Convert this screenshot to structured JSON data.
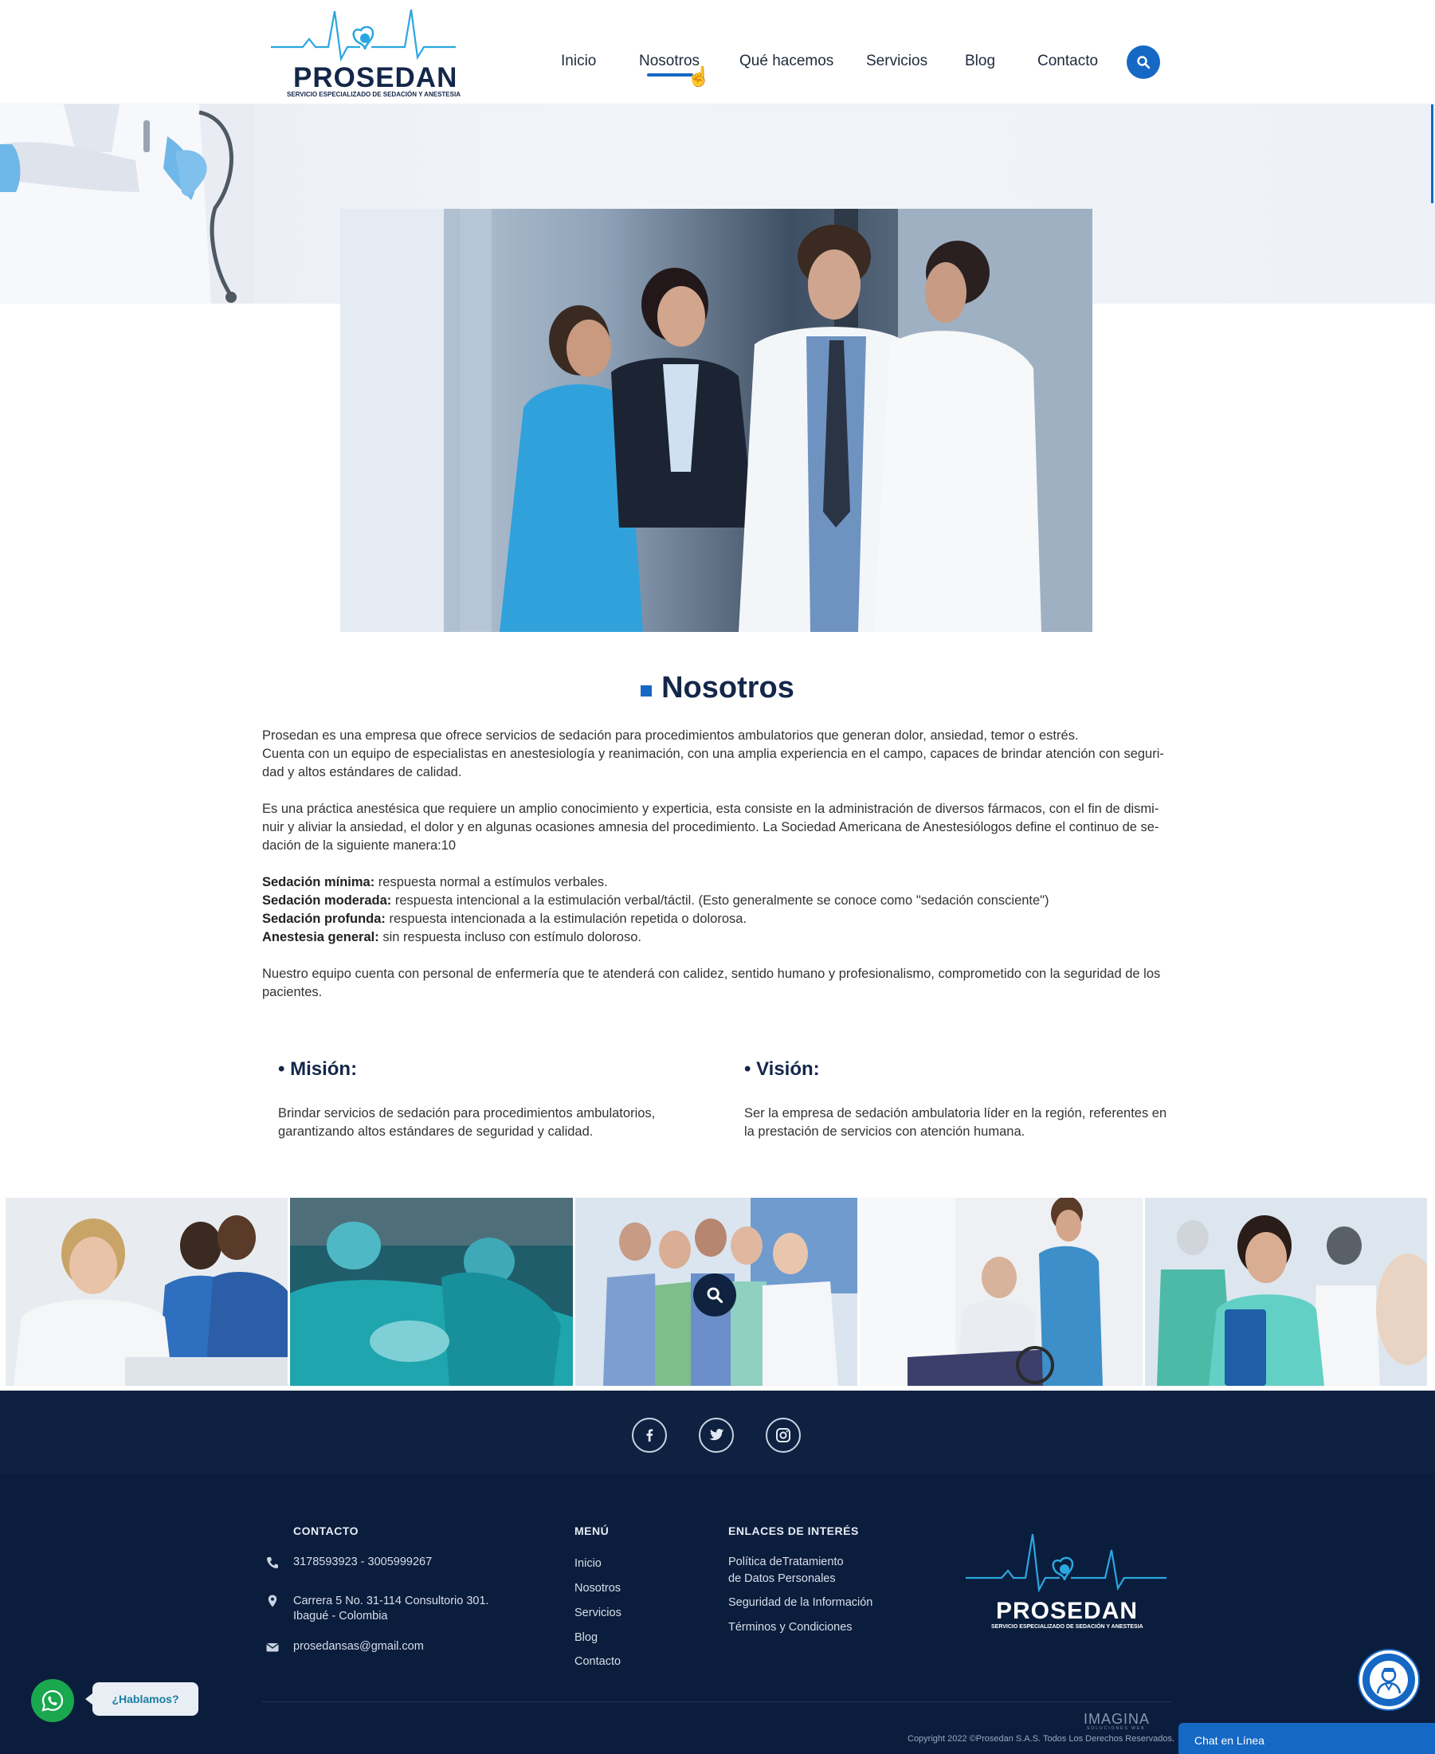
{
  "brand": {
    "name": "PROSEDAN",
    "tagline": "SERVICIO ESPECIALIZADO DE SEDACIÓN Y ANESTESIA",
    "primary_color": "#1568c4",
    "navy_color": "#0b1d3c"
  },
  "nav": {
    "items": [
      "Inicio",
      "Nosotros",
      "Qué hacemos",
      "Servicios",
      "Blog",
      "Contacto"
    ],
    "active": "Nosotros",
    "search_icon": "search-icon"
  },
  "page": {
    "title": "Nosotros",
    "paragraphs": {
      "p1a": "Prosedan es una empresa que ofrece servicios de sedación para procedimientos ambulatorios que generan dolor, ansiedad, temor o estrés.",
      "p1b": "Cuenta con un equipo de especialistas en anestesiología y reanimación, con una amplia experiencia en el campo, capaces de brindar atención con seguri-dad y altos estándares de calidad.",
      "p2": "Es una práctica anestésica que requiere un amplio conocimiento y experticia, esta consiste en la administración de diversos fármacos, con el fin de dismi-nuir y aliviar la ansiedad, el dolor y en algunas ocasiones amnesia del procedimiento. La Sociedad Americana de Anestesiólogos define el continuo de se-dación de la siguiente manera:10",
      "levels": [
        {
          "term": "Sedación mínima:",
          "desc": " respuesta normal a estímulos verbales."
        },
        {
          "term": "Sedación moderada:",
          "desc": " respuesta intencional a la estimulación verbal/táctil. (Esto generalmente se conoce como \"sedación consciente\")"
        },
        {
          "term": "Sedación profunda:",
          "desc": " respuesta intencionada a la estimulación repetida o dolorosa."
        },
        {
          "term": "Anestesia general:",
          "desc": " sin respuesta  incluso con estímulo doloroso."
        }
      ],
      "p4": "Nuestro equipo cuenta con personal de enfermería que te atenderá con calidez, sentido humano y profesionalismo, comprometido con la seguridad de los pacientes."
    },
    "mision": {
      "title": "• Misión:",
      "text": "Brindar servicios de sedación para procedimientos ambulatorios, garantizando altos estándares de seguridad y calidad."
    },
    "vision": {
      "title": "• Visión:",
      "text": "Ser la empresa de sedación ambulatoria líder en la región, referentes en la prestación de servicios con atención humana."
    }
  },
  "gallery": {
    "count": 5,
    "zoom_icon": "search-icon"
  },
  "social": [
    "facebook-icon",
    "twitter-icon",
    "instagram-icon"
  ],
  "footer": {
    "contact_heading": "CONTACTO",
    "phone": "3178593923 - 3005999267",
    "address_line1": "Carrera 5 No. 31-114 Consultorio 301.",
    "address_line2": "Ibagué - Colombia",
    "email": "prosedansas@gmail.com",
    "menu_heading": "MENÚ",
    "menu": [
      "Inicio",
      "Nosotros",
      "Servicios",
      "Blog",
      "Contacto"
    ],
    "links_heading": "ENLACES DE INTERÉS",
    "links": {
      "privacy_line1": "Política deTratamiento",
      "privacy_line2": "de Datos Personales",
      "security": "Seguridad de la Información",
      "terms": "Términos y Condiciones"
    },
    "agency": "IMAGINA",
    "agency_sub": "SOLUCIONES WEB",
    "copyright": "Copyright 2022 ©Prosedan S.A.S. Todos Los Derechos Reservados."
  },
  "widgets": {
    "whatsapp_label": "¿Hablamos?",
    "chat_label": "Chat en Línea"
  }
}
